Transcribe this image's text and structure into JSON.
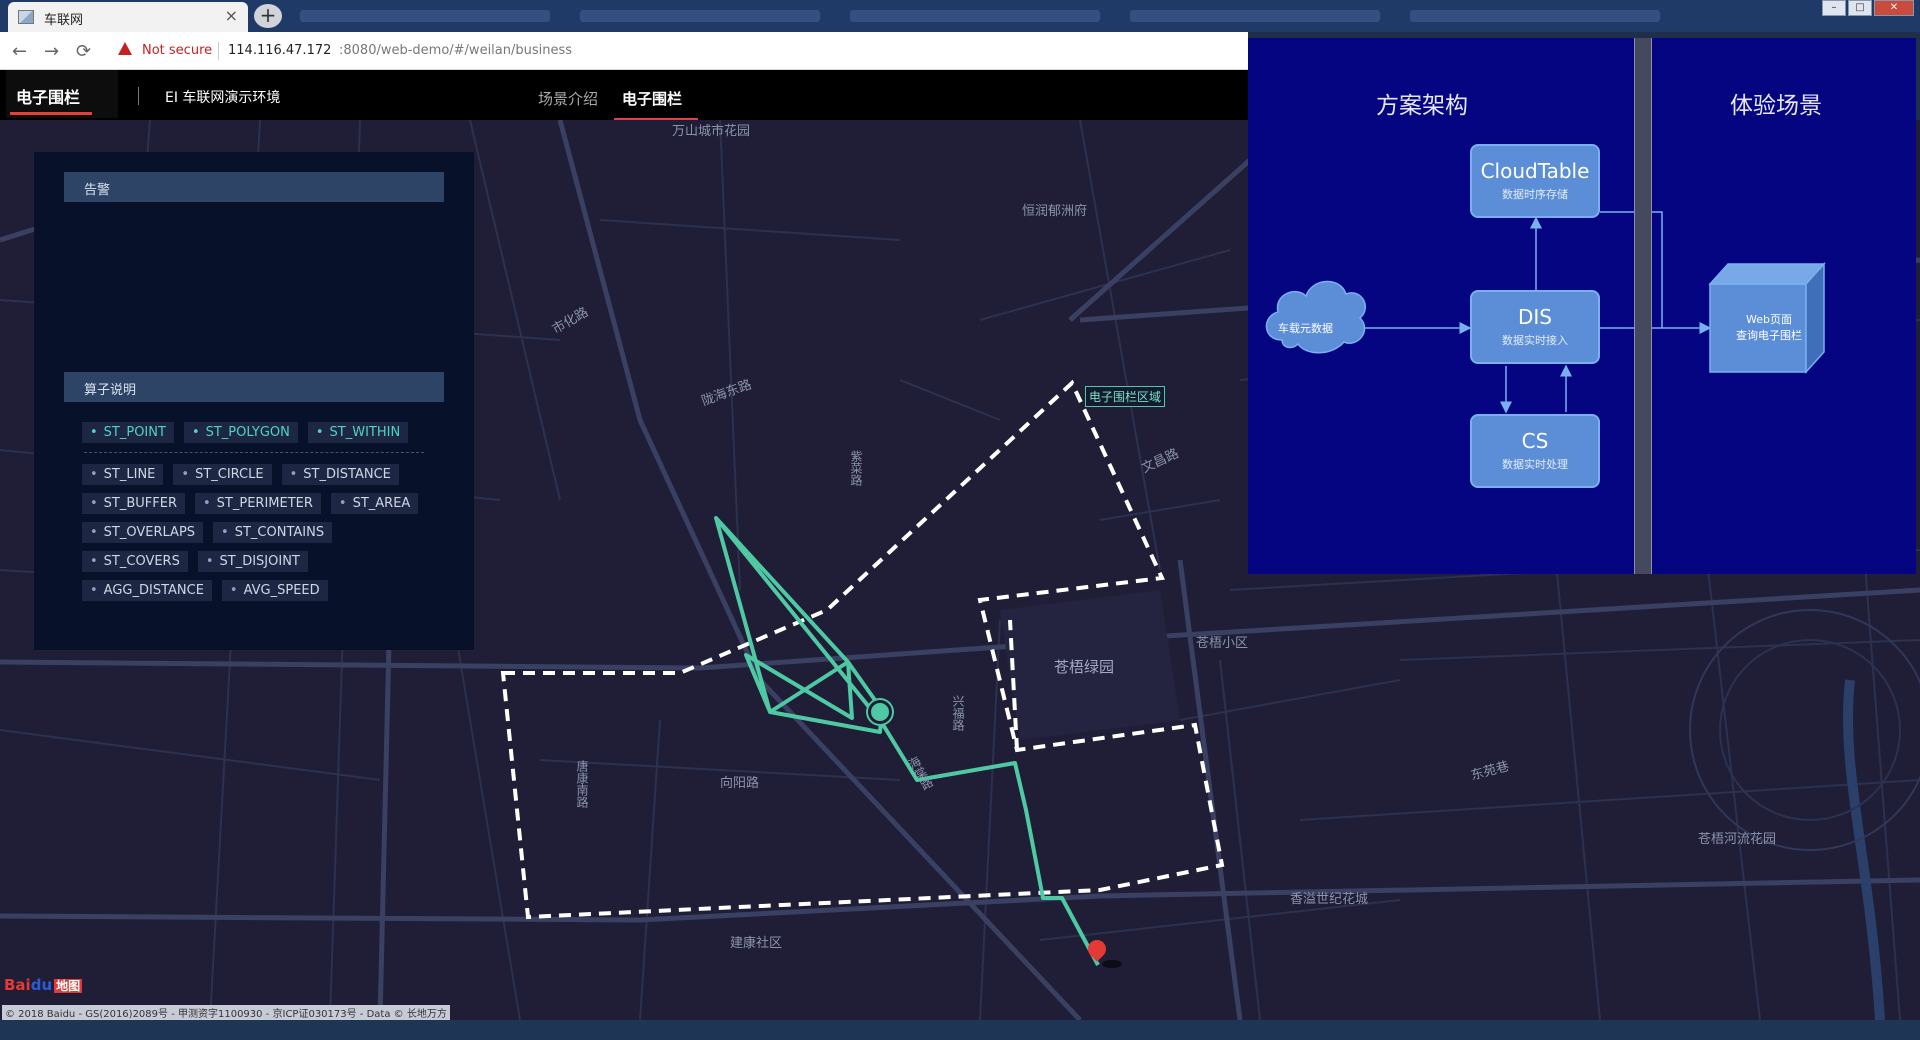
{
  "browser": {
    "tab_title": "车联网",
    "tab_close": "×",
    "new_tab": "+",
    "security_label": "Not secure",
    "url_host": "114.116.47.172",
    "url_rest": ":8080/web-demo/#/weilan/business",
    "back": "←",
    "forward": "→",
    "reload": "⟳",
    "window_buttons": {
      "minimize": "–",
      "maximize": "□",
      "close": "✕"
    }
  },
  "header": {
    "brand": "电子围栏",
    "env_title": "EI 车联网演示环境",
    "tabs": [
      {
        "label": "场景介绍",
        "active": false
      },
      {
        "label": "电子围栏",
        "active": true
      }
    ]
  },
  "panel": {
    "alert_title": "告警",
    "operators_title": "算子说明",
    "highlighted_operators": [
      "ST_POINT",
      "ST_POLYGON",
      "ST_WITHIN"
    ],
    "operators": [
      "ST_LINE",
      "ST_CIRCLE",
      "ST_DISTANCE",
      "ST_BUFFER",
      "ST_PERIMETER",
      "ST_AREA",
      "ST_OVERLAPS",
      "ST_CONTAINS",
      "ST_COVERS",
      "ST_DISJOINT",
      "AGG_DISTANCE",
      "AVG_SPEED"
    ]
  },
  "map": {
    "zone_label": "电子围栏区域",
    "labels": {
      "wanshan": "万山城市花园",
      "hengrun": "恒润郁洲府",
      "shihua": "市化路",
      "lianhai": "陇海东路",
      "ziyun": "紫菜路",
      "wenyi": "文昌路",
      "cangwu_park": "苍梧绿园",
      "cangwu_xiaoqu": "苍梧小区",
      "xingfu": "兴福路",
      "xiangyang": "向阳路",
      "tangkang": "唐康南路",
      "dongyuan": "东苑巷",
      "cangwu_river": "苍梧河流花园",
      "xiangyi": "香溢世纪花城",
      "jiankang": "建康社区",
      "haitang": "海棠路"
    },
    "baidu_logo": "Bai",
    "baidu_paw": "du",
    "baidu_tag": "地图",
    "copyright": "© 2018 Baidu - GS(2016)2089号 - 甲测资字1100930 - 京ICP证030173号 - Data © 长地万方"
  },
  "architecture": {
    "title_left": "方案架构",
    "title_right": "体验场景",
    "cloud_label": "车载元数据",
    "boxes": {
      "cloudtable": {
        "name": "CloudTable",
        "sub": "数据时序存储"
      },
      "dis": {
        "name": "DIS",
        "sub": "数据实时接入"
      },
      "cs": {
        "name": "CS",
        "sub": "数据实时处理"
      }
    },
    "cube_line1": "Web页面",
    "cube_line2": "查询电子围栏",
    "colors": {
      "background": "#050582",
      "box": "#5b8ed6"
    }
  },
  "colors": {
    "route": "#4fc9a3",
    "fence": "#ffffff",
    "accent": "#e5413b"
  }
}
